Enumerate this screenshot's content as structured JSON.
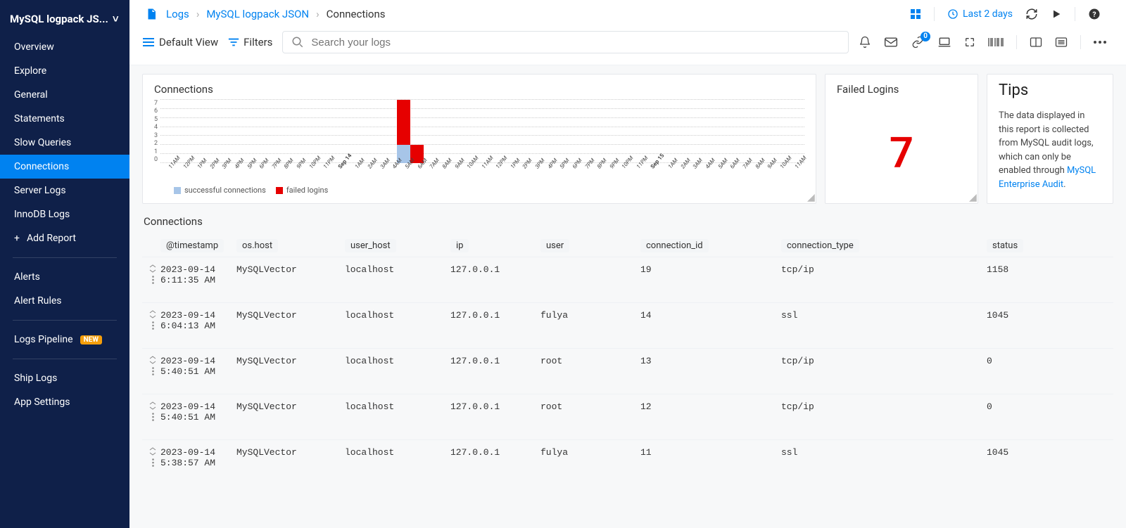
{
  "sidebar": {
    "title": "MySQL logpack JS...",
    "nav": [
      {
        "label": "Overview"
      },
      {
        "label": "Explore"
      },
      {
        "label": "General"
      },
      {
        "label": "Statements"
      },
      {
        "label": "Slow Queries"
      },
      {
        "label": "Connections",
        "active": true
      },
      {
        "label": "Server Logs"
      },
      {
        "label": "InnoDB Logs"
      }
    ],
    "add_report": "Add Report",
    "alerts": "Alerts",
    "alert_rules": "Alert Rules",
    "logs_pipeline": "Logs Pipeline",
    "logs_pipeline_badge": "NEW",
    "ship_logs": "Ship Logs",
    "app_settings": "App Settings"
  },
  "breadcrumb": {
    "l1": "Logs",
    "l2": "MySQL logpack JSON",
    "l3": "Connections"
  },
  "time_range": "Last 2 days",
  "toolbar": {
    "default_view": "Default View",
    "filters": "Filters",
    "search_placeholder": "Search your logs",
    "link_badge": "0"
  },
  "panels": {
    "connections_title": "Connections",
    "failed_title": "Failed Logins",
    "failed_value": "7",
    "tips_title": "Tips",
    "tips_text": "The data displayed in this report is collected from MySQL audit logs, which can only be enabled through ",
    "tips_link": "MySQL Enterprise Audit"
  },
  "chart_data": {
    "type": "bar",
    "title": "Connections",
    "ylabel": "",
    "ylim": [
      0,
      7
    ],
    "y_ticks": [
      7,
      6,
      5,
      4,
      3,
      2,
      1,
      0
    ],
    "categories": [
      "11AM",
      "12PM",
      "1PM",
      "2PM",
      "3PM",
      "4PM",
      "5PM",
      "6PM",
      "7PM",
      "8PM",
      "9PM",
      "10PM",
      "11PM",
      "Sep 14",
      "1AM",
      "2AM",
      "3AM",
      "4AM",
      "5AM",
      "6AM",
      "7AM",
      "8AM",
      "9AM",
      "10AM",
      "11AM",
      "12PM",
      "1PM",
      "2PM",
      "3PM",
      "4PM",
      "5PM",
      "6PM",
      "7PM",
      "8PM",
      "9PM",
      "10PM",
      "11PM",
      "Sep 15",
      "1AM",
      "2AM",
      "3AM",
      "4AM",
      "5AM",
      "6AM",
      "7AM",
      "8AM",
      "9AM",
      "10AM",
      "11AM"
    ],
    "bold_idx": [
      13,
      37
    ],
    "series": [
      {
        "name": "successful connections",
        "color": "#a7c5e8",
        "values": [
          0,
          0,
          0,
          0,
          0,
          0,
          0,
          0,
          0,
          0,
          0,
          0,
          0,
          0,
          0,
          0,
          0,
          0,
          2,
          0,
          0,
          0,
          0,
          0,
          0,
          0,
          0,
          0,
          0,
          0,
          0,
          0,
          0,
          0,
          0,
          0,
          0,
          0,
          0,
          0,
          0,
          0,
          0,
          0,
          0,
          0,
          0,
          0,
          0
        ]
      },
      {
        "name": "failed logins",
        "color": "#e60000",
        "values": [
          0,
          0,
          0,
          0,
          0,
          0,
          0,
          0,
          0,
          0,
          0,
          0,
          0,
          0,
          0,
          0,
          0,
          0,
          5,
          2,
          0,
          0,
          0,
          0,
          0,
          0,
          0,
          0,
          0,
          0,
          0,
          0,
          0,
          0,
          0,
          0,
          0,
          0,
          0,
          0,
          0,
          0,
          0,
          0,
          0,
          0,
          0,
          0,
          0
        ]
      }
    ]
  },
  "table": {
    "title": "Connections",
    "cols": [
      "@timestamp",
      "os.host",
      "user_host",
      "ip",
      "user",
      "connection_id",
      "connection_type",
      "status"
    ],
    "rows": [
      {
        "ts": "2023-09-14 6:11:35 AM",
        "host": "MySQLVector",
        "uh": "localhost",
        "ip": "127.0.0.1",
        "user": "",
        "cid": "19",
        "ct": "tcp/ip",
        "st": "1158"
      },
      {
        "ts": "2023-09-14 6:04:13 AM",
        "host": "MySQLVector",
        "uh": "localhost",
        "ip": "127.0.0.1",
        "user": "fulya",
        "cid": "14",
        "ct": "ssl",
        "st": "1045"
      },
      {
        "ts": "2023-09-14 5:40:51 AM",
        "host": "MySQLVector",
        "uh": "localhost",
        "ip": "127.0.0.1",
        "user": "root",
        "cid": "13",
        "ct": "tcp/ip",
        "st": "0"
      },
      {
        "ts": "2023-09-14 5:40:51 AM",
        "host": "MySQLVector",
        "uh": "localhost",
        "ip": "127.0.0.1",
        "user": "root",
        "cid": "12",
        "ct": "tcp/ip",
        "st": "0"
      },
      {
        "ts": "2023-09-14 5:38:57 AM",
        "host": "MySQLVector",
        "uh": "localhost",
        "ip": "127.0.0.1",
        "user": "fulya",
        "cid": "11",
        "ct": "ssl",
        "st": "1045"
      }
    ]
  }
}
